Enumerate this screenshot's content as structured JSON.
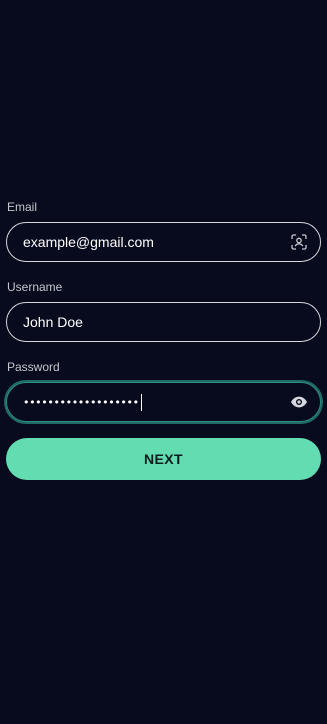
{
  "form": {
    "email": {
      "label": "Email",
      "value": "example@gmail.com",
      "icon": "face-scan-icon"
    },
    "username": {
      "label": "Username",
      "value": "John Doe"
    },
    "password": {
      "label": "Password",
      "masked_value": "•••••••••••••••••••",
      "icon": "eye-icon"
    },
    "submit_label": "NEXT"
  },
  "colors": {
    "background": "#080a1e",
    "accent": "#62dcb0",
    "field_border": "#d6d7dc",
    "focus_border": "#2f8f86"
  }
}
